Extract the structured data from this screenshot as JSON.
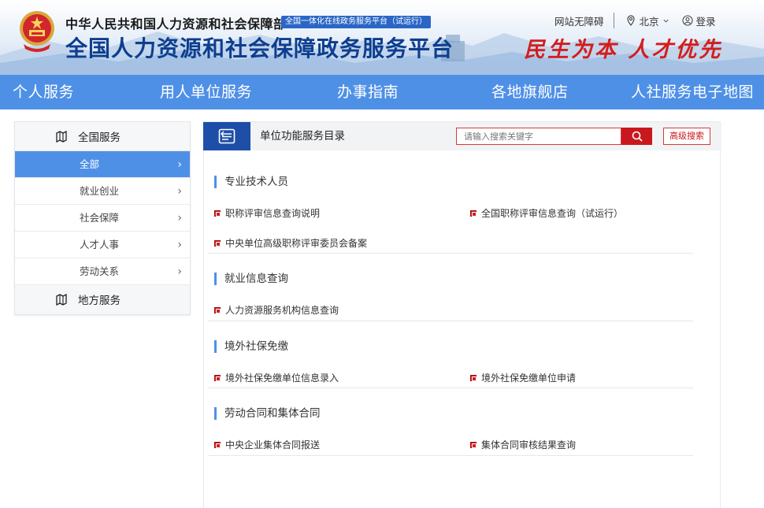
{
  "header": {
    "ministry": "中华人民共和国人力资源和社会保障部",
    "platform_tag": "全国一体化在线政务服务平台（试运行）",
    "site_title": "全国人力资源和社会保障政务服务平台",
    "slogan": "民生为本 人才优先",
    "accessibility_link": "网站无障碍",
    "location": "北京",
    "login": "登录"
  },
  "nav": {
    "items": [
      "个人服务",
      "用人单位服务",
      "办事指南",
      "各地旗舰店",
      "人社服务电子地图"
    ]
  },
  "sidebar": {
    "group_national": "全国服务",
    "items": [
      "全部",
      "就业创业",
      "社会保障",
      "人才人事",
      "劳动关系"
    ],
    "active_index": 0,
    "group_local": "地方服务"
  },
  "panel": {
    "title": "单位功能服务目录",
    "search_placeholder": "请输入搜索关键字",
    "advanced_search": "高级搜索"
  },
  "sections": [
    {
      "title": "专业技术人员",
      "services": [
        "职称评审信息查询说明",
        "全国职称评审信息查询（试运行）",
        "中央单位高级职称评审委员会备案"
      ]
    },
    {
      "title": "就业信息查询",
      "services": [
        "人力资源服务机构信息查询"
      ]
    },
    {
      "title": "境外社保免缴",
      "services": [
        "境外社保免缴单位信息录入",
        "境外社保免缴单位申请"
      ]
    },
    {
      "title": "劳动合同和集体合同",
      "services": [
        "中央企业集体合同报送",
        "集体合同审核结果查询"
      ]
    }
  ],
  "colors": {
    "nav_blue": "#4f90e7",
    "title_blue": "#0d3e8f",
    "accent_red": "#c9181d",
    "slogan_red": "#d21e1e"
  }
}
